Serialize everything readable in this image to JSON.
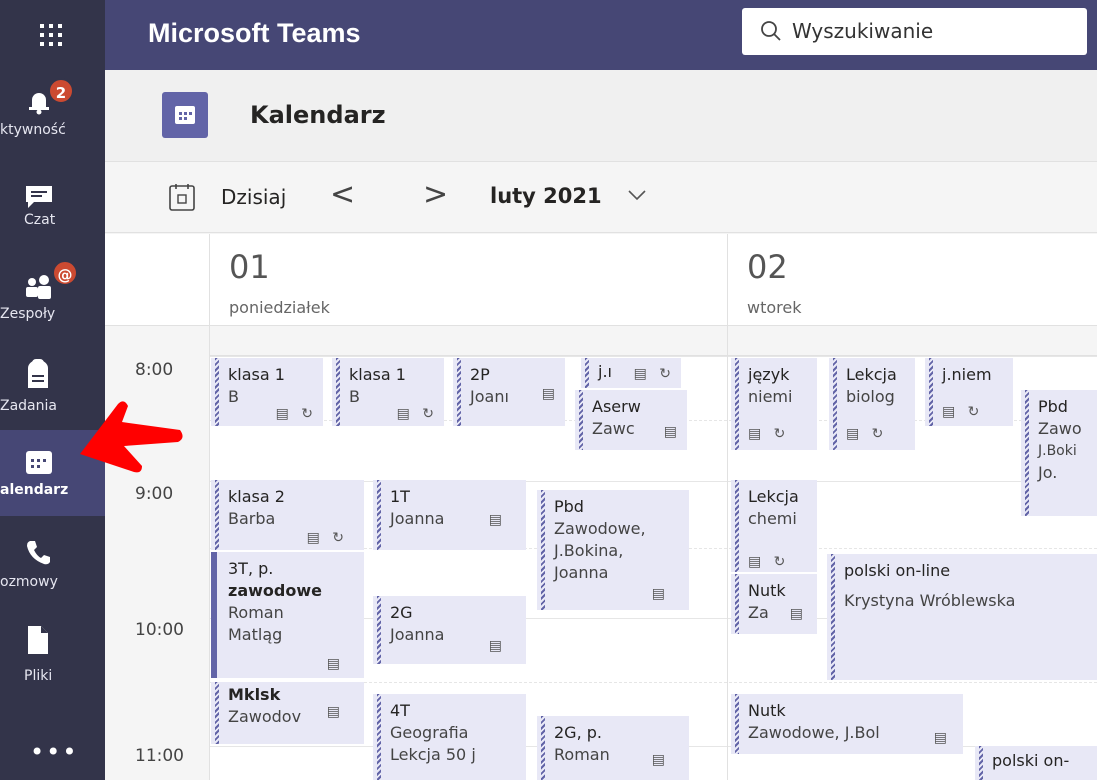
{
  "app": {
    "title": "Microsoft Teams"
  },
  "search": {
    "placeholder": "Wyszukiwanie"
  },
  "rail": {
    "items": [
      {
        "label": "ktywność",
        "badge": "2"
      },
      {
        "label": "Czat"
      },
      {
        "label": "Zespoły",
        "badge": "@"
      },
      {
        "label": "Zadania"
      },
      {
        "label": "alendarz"
      },
      {
        "label": "ozmowy"
      },
      {
        "label": "Pliki"
      }
    ],
    "more": "•••"
  },
  "page": {
    "title": "Kalendarz"
  },
  "toolbar": {
    "today": "Dzisiaj",
    "prev": "<",
    "next": ">",
    "month": "luty 2021"
  },
  "days": [
    {
      "num": "01",
      "name": "poniedziałek"
    },
    {
      "num": "02",
      "name": "wtorek"
    }
  ],
  "times": [
    "8:00",
    "9:00",
    "10:00",
    "11:00"
  ],
  "events": [
    {
      "l1": "klasa 1",
      "l2": "B"
    },
    {
      "l1": "klasa 1",
      "l2": "B"
    },
    {
      "l1": "2P",
      "l2": "Joanı"
    },
    {
      "l1": "j.ı"
    },
    {
      "l1": "Aserw",
      "l2": "Zawc"
    },
    {
      "l1": "klasa 2",
      "l2": "Barba"
    },
    {
      "l1": "1T",
      "l2": "Joanna"
    },
    {
      "l1": "Pbd",
      "l2": "Zawodowe,",
      "l3": "J.Bokina,",
      "l4": "Joanna"
    },
    {
      "l1": "3T, p.",
      "l2": "zawodowe",
      "l3": "Roman",
      "l4": "Matląg"
    },
    {
      "l1": "2G",
      "l2": "Joanna"
    },
    {
      "l1": "Mklsk",
      "l2": "Zawodov"
    },
    {
      "l1": "4T",
      "l2": "Geografia",
      "l3": "Lekcja 50 j"
    },
    {
      "l1": "2G, p.",
      "l2": "Roman"
    },
    {
      "l1": "język",
      "l2": "niemi"
    },
    {
      "l1": "Lekcja",
      "l2": "biolog"
    },
    {
      "l1": "j.niem"
    },
    {
      "l1": "Pbd",
      "l2": "Zawo",
      "l3": "J.Boki",
      "l4": "Jo."
    },
    {
      "l1": "Lekcja",
      "l2": "chemi"
    },
    {
      "l1": "Nutk",
      "l2": "Za"
    },
    {
      "l1": "polski on-line",
      "l2": "Krystyna Wróblewska"
    },
    {
      "l1": "Nutk",
      "l2": "Zawodowe, J.Bol"
    },
    {
      "l1": "polski on-"
    }
  ],
  "colors": {
    "rail": "#33344a",
    "topbar": "#464775",
    "accent": "#6264a7",
    "event_bg": "#e8e8f6",
    "badge": "#cc4a31",
    "arrow": "#ff0000"
  }
}
